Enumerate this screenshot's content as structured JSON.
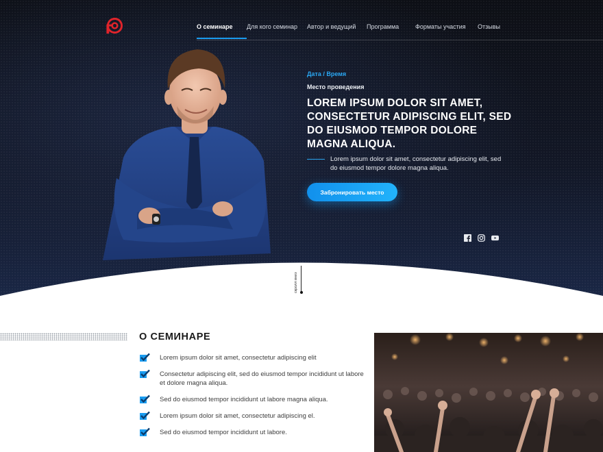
{
  "nav": {
    "logo_icon": "logo-d-icon",
    "items": [
      {
        "label": "О семинаре",
        "active": true
      },
      {
        "label": "Для кого семинар",
        "active": false
      },
      {
        "label": "Автор и ведущий",
        "active": false
      },
      {
        "label": "Программа",
        "active": false
      },
      {
        "label": "Форматы участия",
        "active": false
      },
      {
        "label": "Отзывы",
        "active": false
      }
    ]
  },
  "hero": {
    "date_time": "Дата / Время",
    "venue": "Место проведения",
    "title": "LOREM IPSUM DOLOR SIT AMET, CONSECTETUR ADIPISCING ELIT, SED DO EIUSMOD TEMPOR DOLORE MAGNA ALIQUA.",
    "description": "Lorem ipsum dolor sit amet, consectetur adipiscing elit, sed do eiusmod tempor dolore magna aliqua.",
    "cta_label": "Забронировать место",
    "socials": [
      "facebook-icon",
      "instagram-icon",
      "youtube-icon"
    ],
    "scroll_label": "скролл вниз"
  },
  "about": {
    "title": "О СЕМИНАРЕ",
    "items": [
      "Lorem ipsum dolor sit amet, consectetur adipiscing elit",
      "Consectetur adipiscing elit, sed do eiusmod tempor incididunt ut labore et dolore magna aliqua.",
      "Sed do eiusmod tempor incididunt ut labore  magna aliqua.",
      "Lorem ipsum dolor sit amet, consectetur adipiscing el.",
      "Sed do eiusmod tempor incididunt ut labore."
    ]
  },
  "colors": {
    "accent": "#1a9cf0",
    "logo": "#e0242b",
    "hero_bg": "#10131c"
  }
}
